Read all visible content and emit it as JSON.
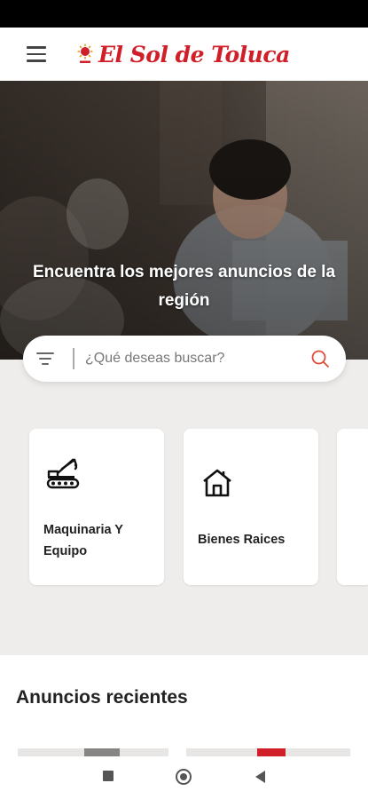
{
  "header": {
    "menu_icon": "hamburger-menu-icon",
    "logo_text": "El Sol de Toluca",
    "logo_color": "#d01f28"
  },
  "hero": {
    "title": "Encuentra los mejores anuncios de la región"
  },
  "search": {
    "placeholder": "¿Qué deseas buscar?",
    "value": "",
    "filter_icon": "filter-icon",
    "search_icon": "search-icon",
    "search_icon_color": "#e04b3a"
  },
  "categories": [
    {
      "label": "Maquinaria Y Equipo",
      "icon": "crane-truck-icon"
    },
    {
      "label": "Bienes Raices",
      "icon": "house-icon"
    }
  ],
  "recent": {
    "title": "Anuncios recientes"
  },
  "navigation": {
    "recents_icon": "square-icon",
    "home_icon": "circle-home-icon",
    "back_icon": "triangle-back-icon"
  }
}
